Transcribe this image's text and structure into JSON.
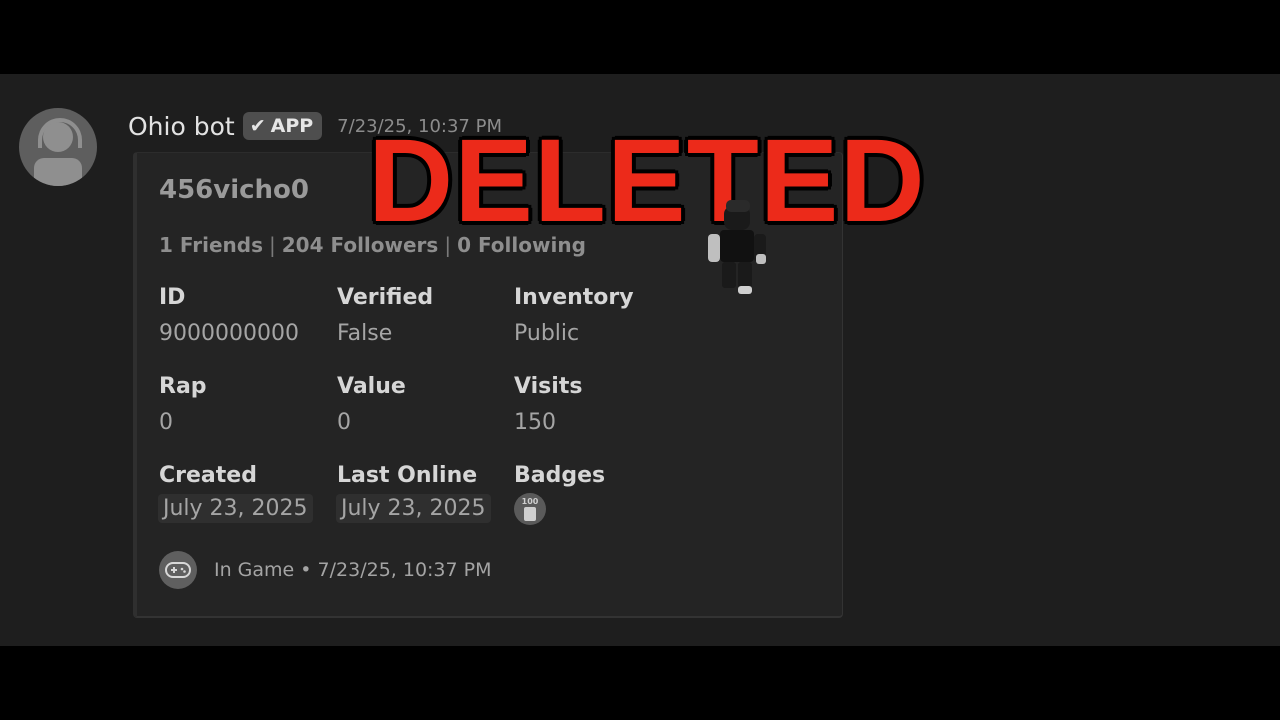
{
  "message": {
    "username": "Ohio bot",
    "app_badge": "APP",
    "timestamp": "7/23/25, 10:37 PM"
  },
  "embed": {
    "title": "456vicho0",
    "stats": {
      "friends": "1 Friends",
      "followers": "204 Followers",
      "following": "0 Following",
      "separator": "|"
    },
    "fields": {
      "id": {
        "name": "ID",
        "value": "9000000000"
      },
      "verified": {
        "name": "Verified",
        "value": "False"
      },
      "inventory": {
        "name": "Inventory",
        "value": "Public"
      },
      "rap": {
        "name": "Rap",
        "value": "0"
      },
      "value": {
        "name": "Value",
        "value": "0"
      },
      "visits": {
        "name": "Visits",
        "value": "150"
      },
      "created": {
        "name": "Created",
        "value": "July 23, 2025"
      },
      "last_online": {
        "name": "Last Online",
        "value": "July 23, 2025"
      },
      "badges": {
        "name": "Badges",
        "badge_icon": "100-visits-badge-icon",
        "badge_text": "100"
      }
    },
    "footer": {
      "icon": "gamepad-icon",
      "text": "In Game • 7/23/25, 10:37 PM"
    }
  },
  "overlay": {
    "stamp": "DELETED",
    "stamp_color": "#ec2a1a"
  }
}
